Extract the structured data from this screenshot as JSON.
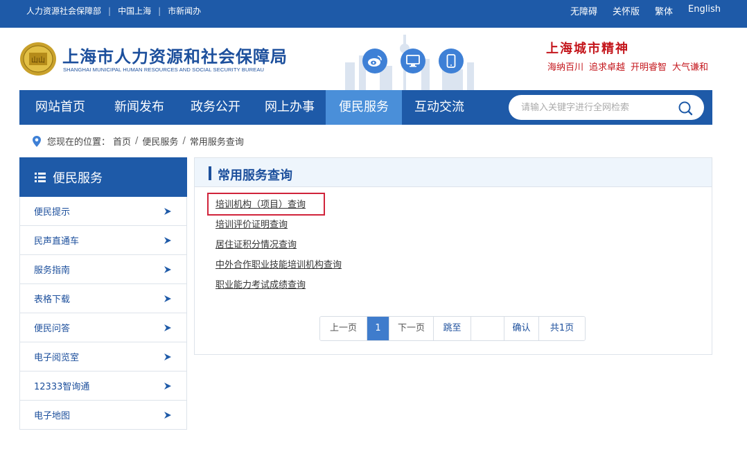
{
  "topbar": {
    "left_links": [
      "人力资源社会保障部",
      "中国上海",
      "市新闻办"
    ],
    "separator": "|",
    "right_links": [
      "无障碍",
      "关怀版",
      "繁体",
      "English"
    ]
  },
  "header": {
    "title": "上海市人力资源和社会保障局",
    "subtitle": "SHANGHAI MUNICIPAL HUMAN RESOURCES AND SOCIAL SECURITY BUREAU",
    "emblem_text": "山山",
    "social_icons": [
      "weibo-icon",
      "desktop-icon",
      "mobile-icon"
    ],
    "spirit_title": "上海城市精神",
    "spirit_words": [
      "海纳百川",
      "追求卓越",
      "开明睿智",
      "大气谦和"
    ]
  },
  "nav": {
    "items": [
      "网站首页",
      "新闻发布",
      "政务公开",
      "网上办事",
      "便民服务",
      "互动交流"
    ],
    "active": "便民服务",
    "search_placeholder": "请输入关键字进行全网检索"
  },
  "breadcrumb": {
    "label": "您现在的位置：",
    "crumbs": [
      "首页",
      "便民服务",
      "常用服务查询"
    ],
    "separator": "/"
  },
  "sidebar": {
    "title": "便民服务",
    "items": [
      "便民提示",
      "民声直通车",
      "服务指南",
      "表格下载",
      "便民问答",
      "电子阅览室",
      "12333智询通",
      "电子地图"
    ]
  },
  "main": {
    "title": "常用服务查询",
    "links": [
      "培训机构（项目）查询",
      "培训评价证明查询",
      "居住证积分情况查询",
      "中外合作职业技能培训机构查询",
      "职业能力考试成绩查询"
    ],
    "highlighted_link": "培训机构（项目）查询",
    "pager": {
      "prev": "上一页",
      "current": "1",
      "next": "下一页",
      "jump": "跳至",
      "jump_value": "",
      "confirm": "确认",
      "total": "共1页"
    }
  },
  "colors": {
    "primary": "#1e5aa8",
    "nav_active": "#4a8fd9",
    "spirit_red": "#c4161c",
    "highlight_red": "#d0233a"
  }
}
